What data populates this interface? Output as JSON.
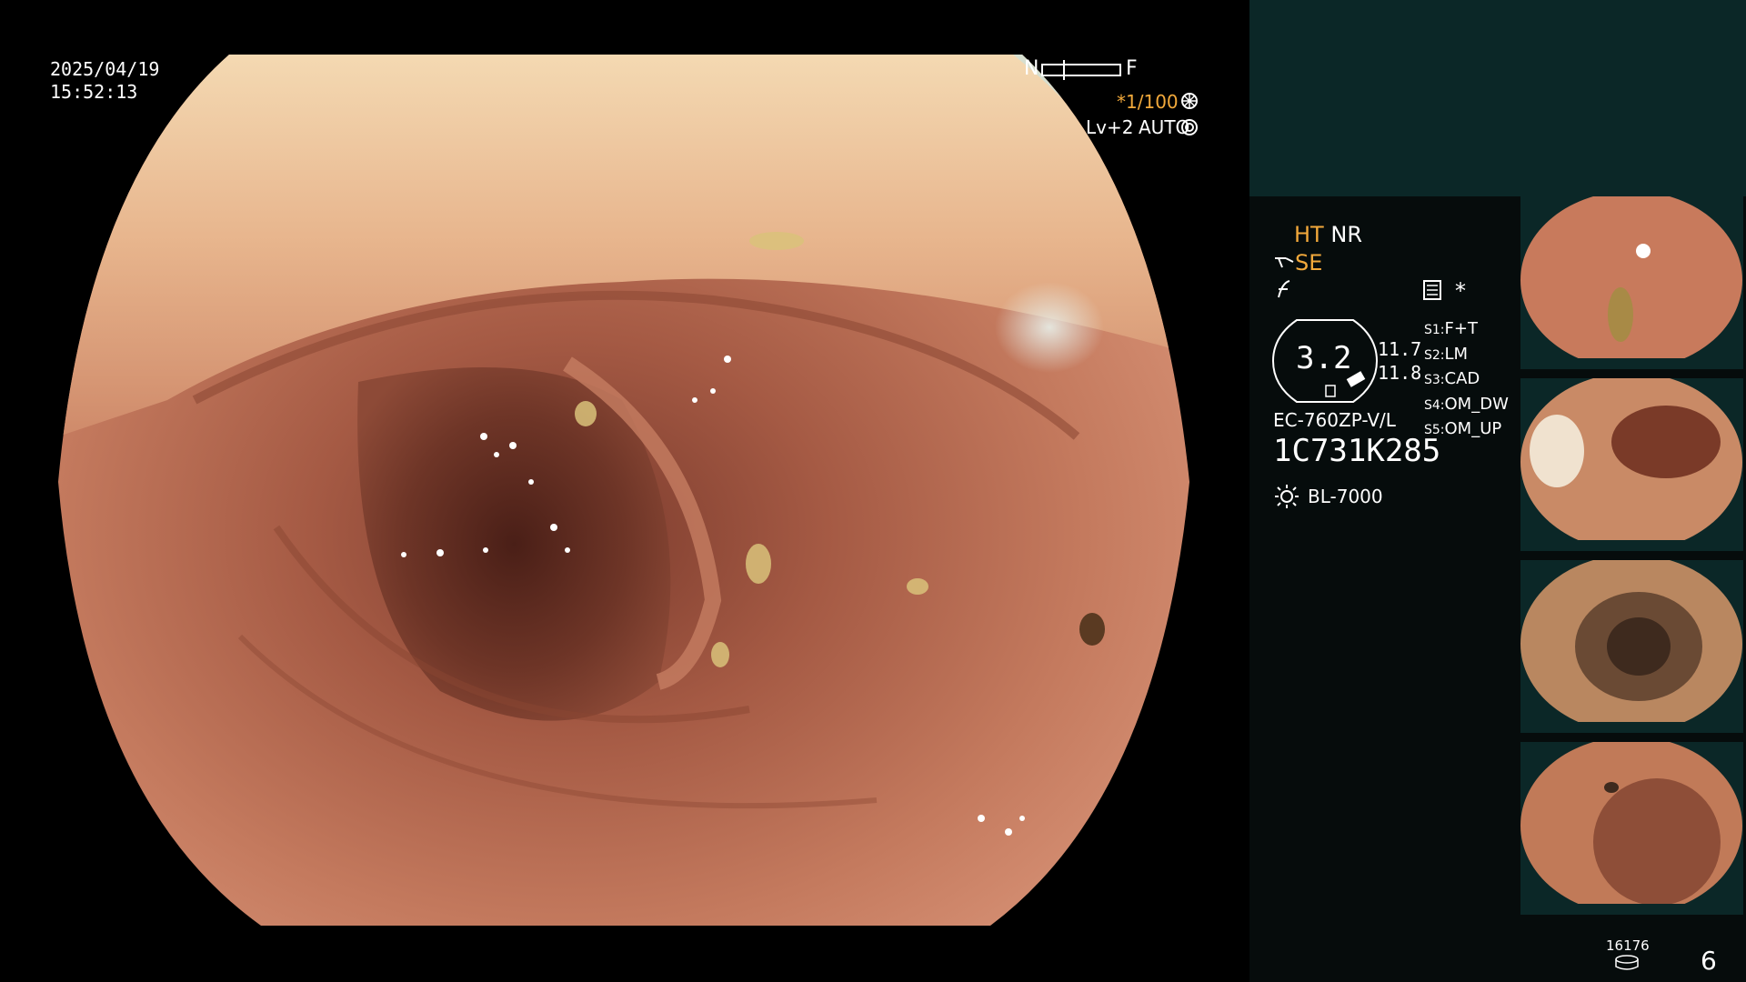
{
  "header": {
    "date": "2025/04/19",
    "time": "15:52:13"
  },
  "view_status": {
    "focus_near": "N",
    "focus_far": "F",
    "shutter": "*1/100",
    "level": "Lv+2",
    "mode": "AUTO"
  },
  "side_panel": {
    "ht": "HT",
    "nr": "NR",
    "se": "SE",
    "star": "*",
    "zoom": "3.2",
    "left_values": [
      "11.7",
      "11.8"
    ],
    "scope_model": "EC-760ZP-V/L",
    "serial": "1C731K285",
    "light_source": "BL-7000",
    "settings": [
      {
        "key": "S1:",
        "value": "F+T"
      },
      {
        "key": "S2:",
        "value": "LM"
      },
      {
        "key": "S3:",
        "value": "CAD"
      },
      {
        "key": "S4:",
        "value": "OM_DW"
      },
      {
        "key": "S5:",
        "value": "OM_UP"
      }
    ],
    "counter": "16176",
    "page_number": "6"
  },
  "colors": {
    "panel_bg": "#060c0c",
    "panel_top": "#0b2727",
    "accent": "#f2a93b",
    "mucosa": "#b46a50"
  },
  "icons": [
    "shutter-icon",
    "auto-icon",
    "se-icon",
    "f-icon",
    "menu-icon",
    "light-icon",
    "storage-icon"
  ]
}
